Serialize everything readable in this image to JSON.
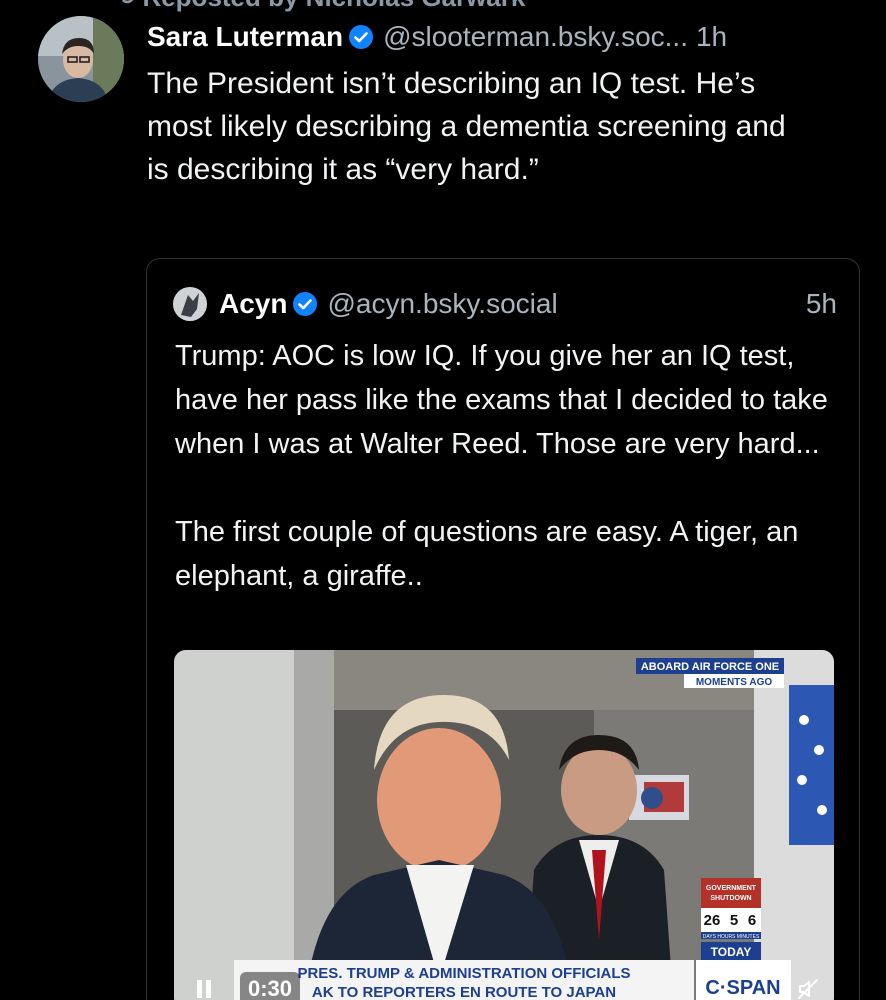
{
  "repost": {
    "label": "Reposted by Nicholas Garwark"
  },
  "post": {
    "display_name": "Sara Luterman",
    "handle": "@slooterman.bsky.soc...",
    "time": "1h",
    "text": "The President isn’t describing an IQ test. He’s most likely describing a dementia screening and is describing it as “very hard.”"
  },
  "quote": {
    "display_name": "Acyn",
    "handle": "@acyn.bsky.social",
    "time": "5h",
    "text": "Trump: AOC is low IQ. If you give her an IQ test, have her pass like the exams that I decided to take when I was at Walter Reed. Those are very hard...\n\nThe first couple of questions are easy. A tiger, an elephant, a giraffe.."
  },
  "video": {
    "top_banner_line1": "ABOARD AIR FORCE ONE",
    "top_banner_line2": "MOMENTS AGO",
    "shutdown_label_line1": "GOVERNMENT",
    "shutdown_label_line2": "SHUTDOWN",
    "shutdown_days": "26",
    "shutdown_hours": "5",
    "shutdown_minutes": "6",
    "shutdown_units": "DAYS  HOURS  MINUTES",
    "today_label": "TODAY",
    "network": "C·SPAN",
    "chyron_line1": "PRES. TRUMP & ADMINISTRATION OFFICIALS",
    "chyron_line2": "AK TO REPORTERS EN ROUTE TO JAPAN",
    "timestamp": "0:30",
    "play_state_icon": "pause-icon",
    "mute_icon": "mute-icon"
  },
  "colors": {
    "background": "#000000",
    "verified": "#1083fe",
    "secondary_text": "#aab4be",
    "cspan_blue": "#1d3f8f"
  }
}
